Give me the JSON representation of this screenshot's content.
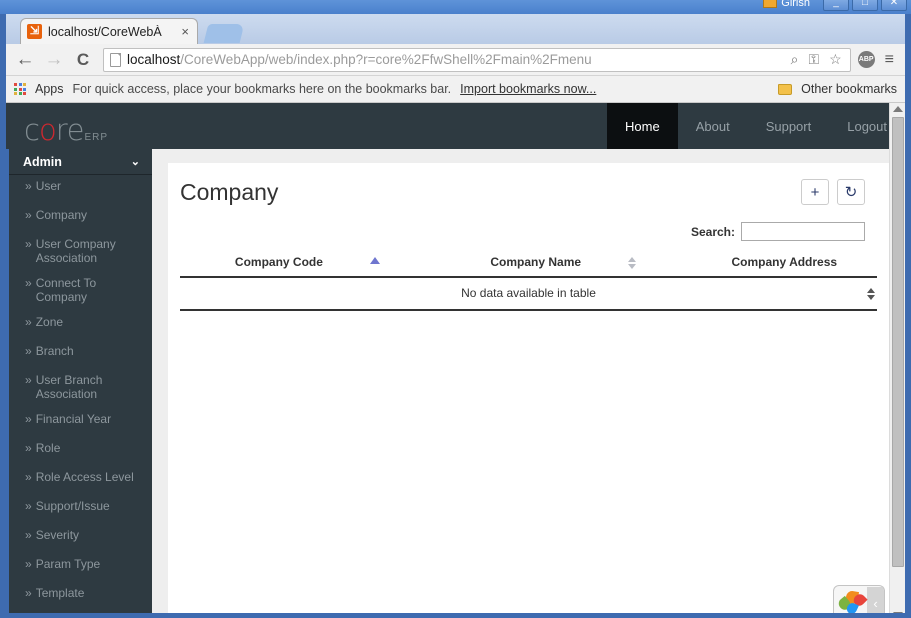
{
  "os": {
    "user": "Girish",
    "minimize": "_",
    "maximize": "□",
    "close": "✕"
  },
  "browser": {
    "tab": {
      "favicon_glyph": "✳",
      "title": "localhost/CoreWebÀ",
      "close_glyph": "×"
    },
    "nav": {
      "back": "←",
      "forward": "→",
      "reload": "C"
    },
    "omnibox": {
      "url_host": "localhost",
      "url_path": "/CoreWebApp/web/index.php?r=core%2FfwShell%2Fmain%2Fmenu",
      "zoom_icon": "⌕",
      "key_icon": "⚿",
      "star_icon": "☆",
      "abp_label": "ABP",
      "menu_icon": "≡"
    },
    "bookmarks": {
      "apps_label": "Apps",
      "hint": "For quick access, place your bookmarks here on the bookmarks bar.",
      "import_link": "Import bookmarks now...",
      "other_bookmarks": "Other bookmarks"
    }
  },
  "app": {
    "logo": {
      "part1": "c",
      "part2": "o",
      "part3": "r",
      "part4": "e",
      "suffix": "ERP"
    },
    "topnav": [
      {
        "label": "Home",
        "active": true
      },
      {
        "label": "About",
        "active": false
      },
      {
        "label": "Support",
        "active": false
      },
      {
        "label": "Logout",
        "active": false
      }
    ],
    "sidebar": {
      "heading": "Admin",
      "chevron": "⌄",
      "bullet": "»",
      "items": [
        {
          "label": "User"
        },
        {
          "label": "Company"
        },
        {
          "label": "User Company Association"
        },
        {
          "label": "Connect To Company"
        },
        {
          "label": "Zone"
        },
        {
          "label": "Branch"
        },
        {
          "label": "User Branch Association"
        },
        {
          "label": "Financial Year"
        },
        {
          "label": "Role"
        },
        {
          "label": "Role Access Level"
        },
        {
          "label": "Support/Issue"
        },
        {
          "label": "Severity"
        },
        {
          "label": "Param Type"
        },
        {
          "label": "Template"
        }
      ]
    },
    "page": {
      "title": "Company",
      "add_button": "+",
      "refresh_button": "↻",
      "search_label": "Search:",
      "search_value": "",
      "search_placeholder": ""
    },
    "table": {
      "columns": [
        {
          "label": "Company Code",
          "sort": "asc"
        },
        {
          "label": "Company Name",
          "sort": "both"
        },
        {
          "label": "Company Address",
          "sort": "none"
        }
      ],
      "rows": [],
      "empty_message": "No data available in table"
    },
    "widget": {
      "collapse_glyph": "‹"
    }
  },
  "colors": {
    "app_dark": "#2e3a41",
    "nav_active": "#0c0f11",
    "logo_accent": "#d0282f",
    "sort_active": "#6f76cf",
    "window_blue": "#3e6bb0"
  }
}
